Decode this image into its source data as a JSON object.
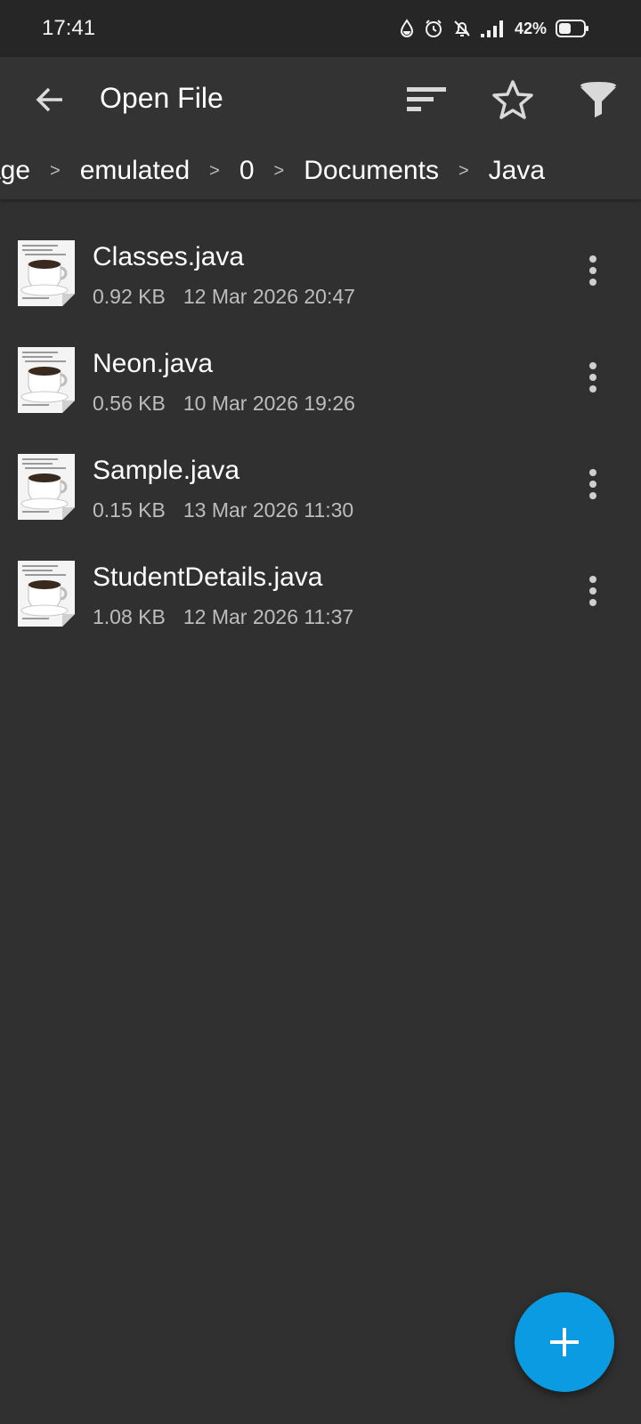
{
  "status_bar": {
    "time": "17:41",
    "battery": "42%",
    "icons": [
      "water-drop-icon",
      "alarm-icon",
      "bell-muted-icon",
      "signal-icon",
      "battery-icon"
    ]
  },
  "app_bar": {
    "title": "Open File",
    "actions": [
      "sort-icon",
      "star-icon",
      "filter-icon"
    ]
  },
  "breadcrumb": [
    "rage",
    "emulated",
    "0",
    "Documents",
    "Java"
  ],
  "breadcrumb_separator": ">",
  "files": [
    {
      "name": "Classes.java",
      "size": "0.92 KB",
      "modified": "12 Mar 2026 20:47"
    },
    {
      "name": "Neon.java",
      "size": "0.56 KB",
      "modified": "10 Mar 2026 19:26"
    },
    {
      "name": "Sample.java",
      "size": "0.15 KB",
      "modified": "13 Mar 2026 11:30"
    },
    {
      "name": "StudentDetails.java",
      "size": "1.08 KB",
      "modified": "12 Mar 2026 11:37"
    }
  ],
  "colors": {
    "background": "#303030",
    "app_bar": "#333333",
    "status_bar": "#262626",
    "fab": "#0a9be3",
    "secondary_text": "#bdbdbd"
  }
}
